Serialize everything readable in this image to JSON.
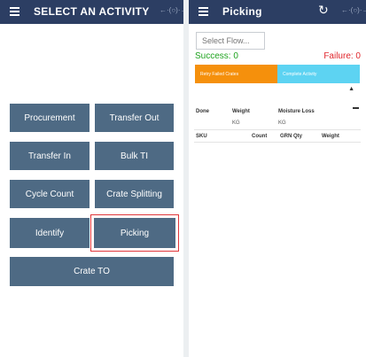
{
  "left": {
    "title": "SELECT AN ACTIVITY",
    "logo_text": "←·(○)·→",
    "activities": [
      {
        "label": "Procurement"
      },
      {
        "label": "Transfer Out"
      },
      {
        "label": "Transfer In"
      },
      {
        "label": "Bulk TI"
      },
      {
        "label": "Cycle Count"
      },
      {
        "label": "Crate Splitting"
      },
      {
        "label": "Identify"
      },
      {
        "label": "Picking"
      },
      {
        "label": "Crate TO"
      }
    ],
    "highlighted": "Picking"
  },
  "right": {
    "title": "Picking",
    "logo_text": "←·(○)·→",
    "refresh_icon": "↻",
    "flow_select": {
      "placeholder": "Select Flow..."
    },
    "success": "Success: 0",
    "failure": "Failure: 0",
    "retry_button": "Retry Failed Crates",
    "complete_button": "Complete Activity",
    "caret_icon": "▲",
    "summary": {
      "done_label": "Done",
      "weight_label": "Weight",
      "weight_unit": "KG",
      "moisture_label": "Moisture Loss",
      "moisture_unit": "KG"
    },
    "table_headers": [
      "SKU",
      "Count",
      "GRN Qty",
      "Weight"
    ]
  },
  "colors": {
    "appbar": "#2c3e63",
    "button": "#4e6a84",
    "highlight": "#e0363a",
    "success": "#1fa31f",
    "failure": "#e0262c",
    "retry": "#f5900c",
    "complete": "#5dd3f2"
  }
}
